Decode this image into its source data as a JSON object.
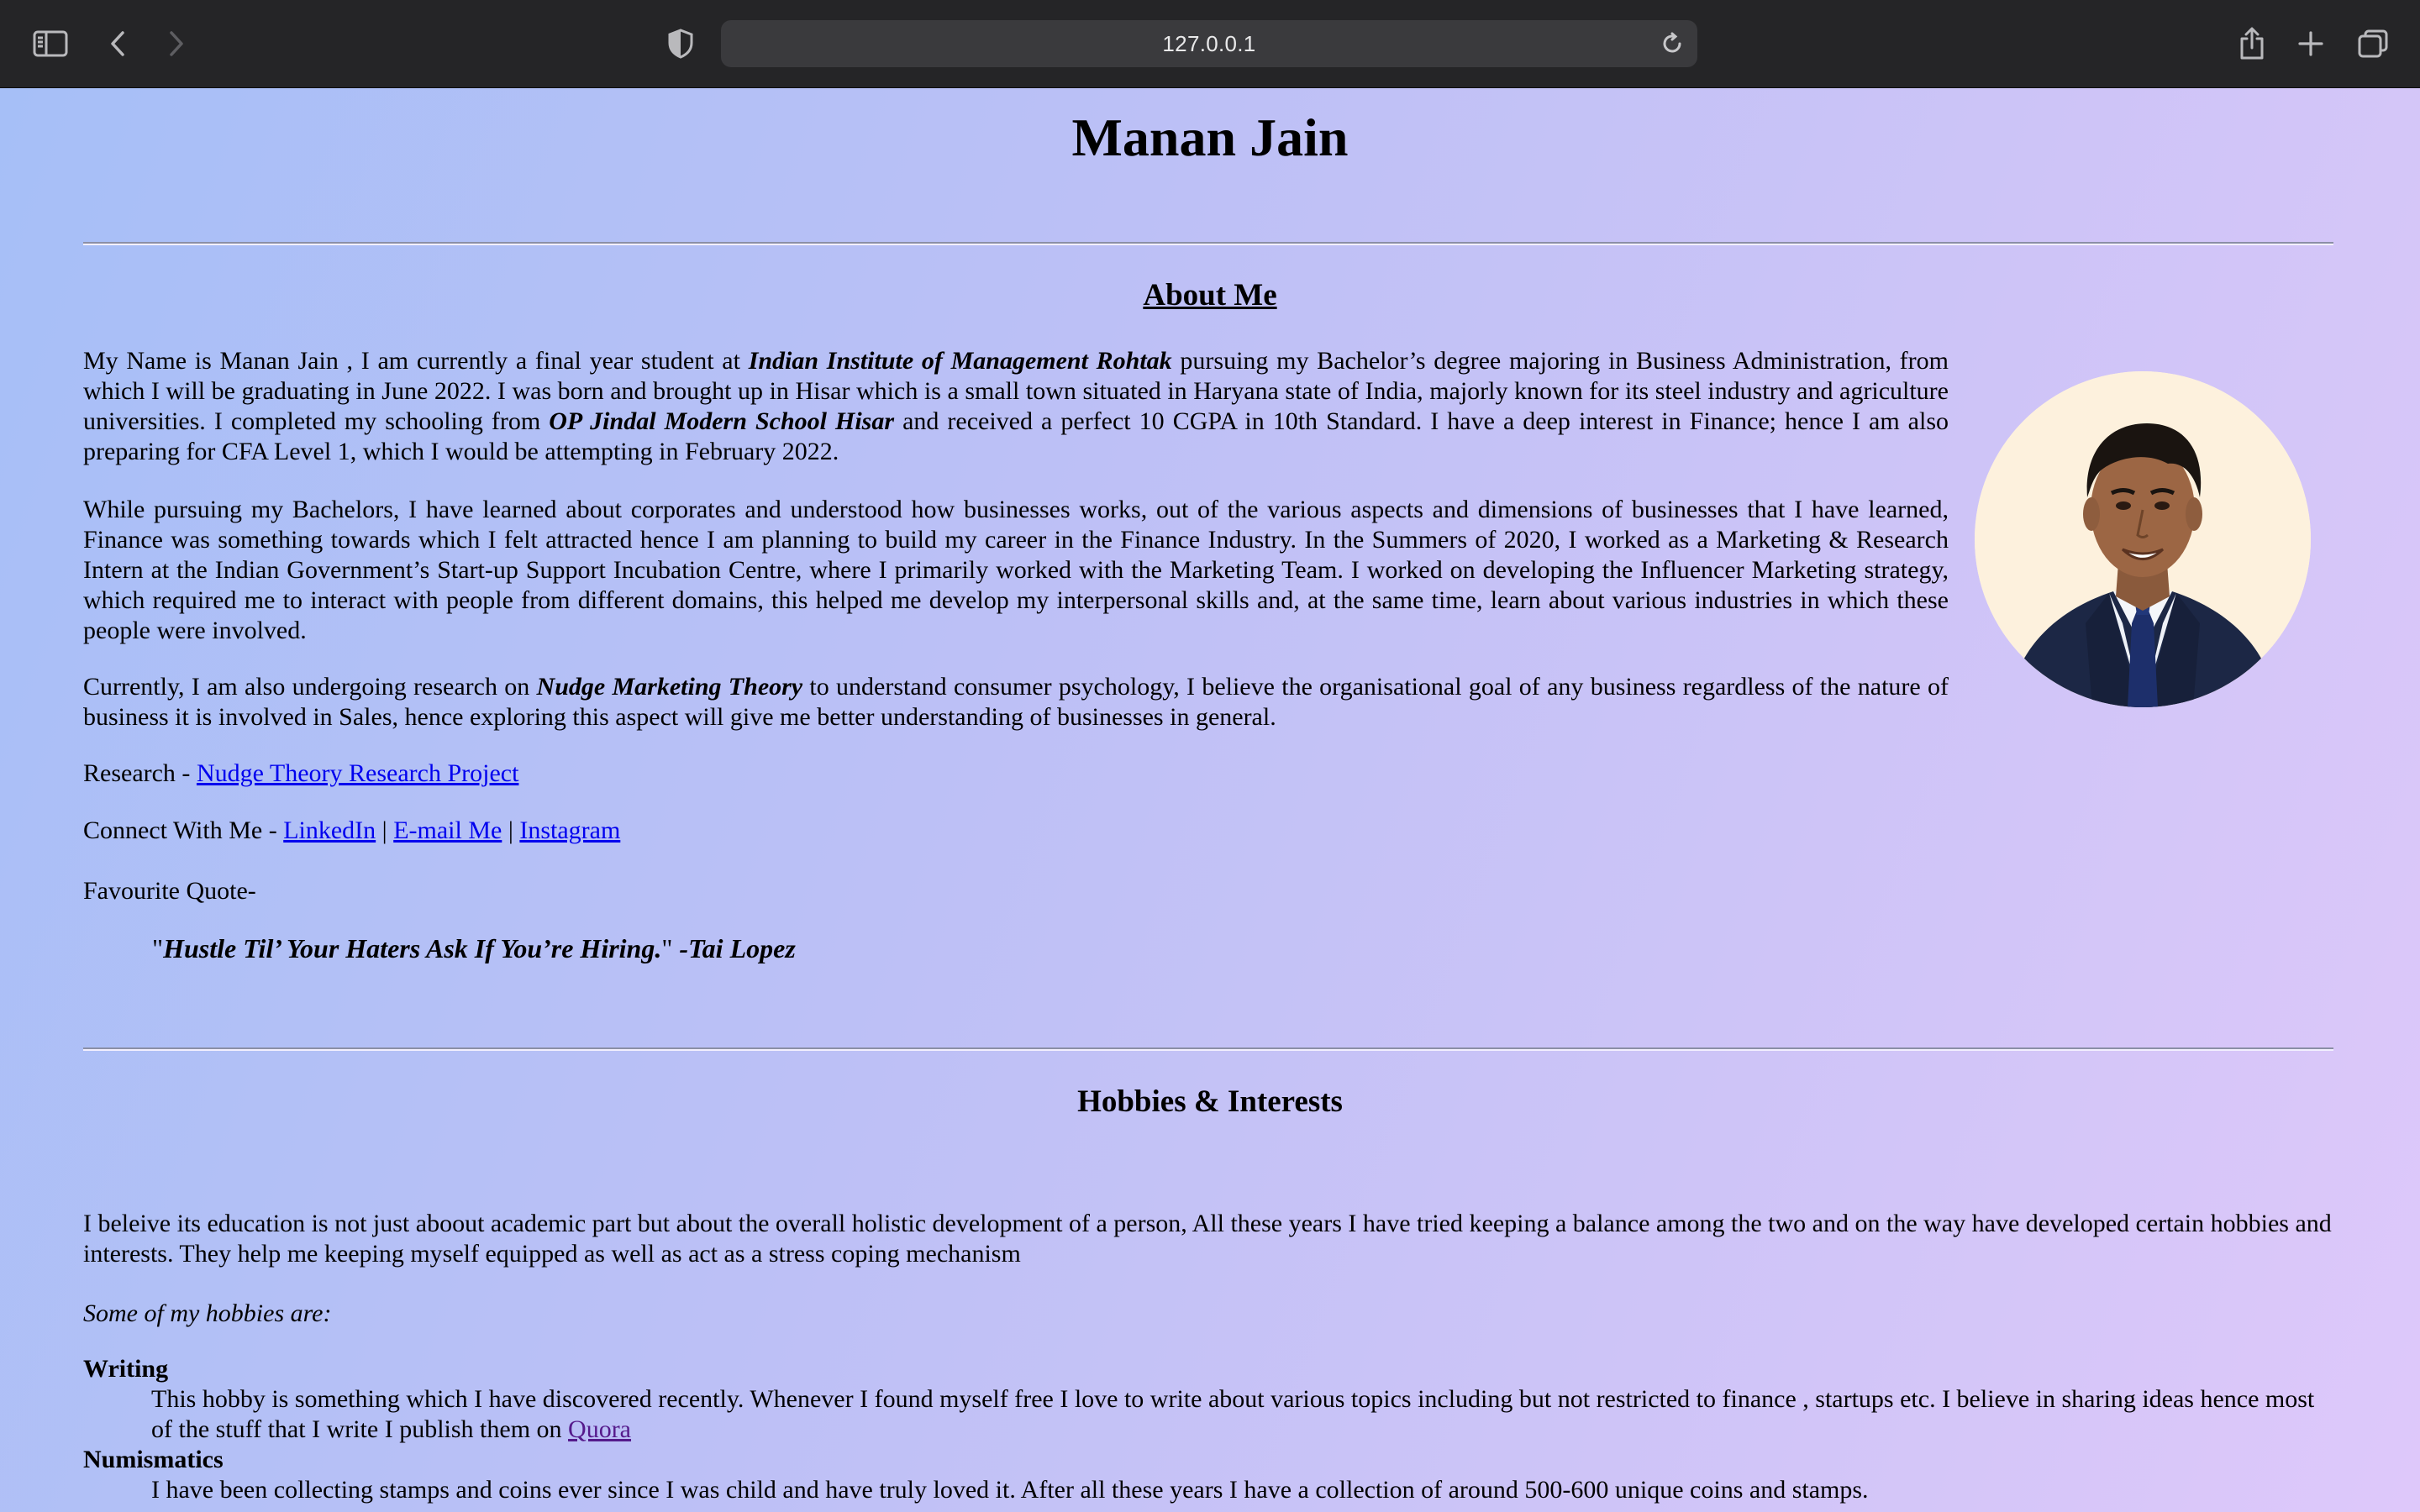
{
  "browser": {
    "url": "127.0.0.1",
    "icons": {
      "sidebar": "sidebar-icon",
      "back": "chevron-left-icon",
      "forward": "chevron-right-icon",
      "privacy": "shield-icon",
      "reload": "reload-icon",
      "share": "share-icon",
      "new_tab": "plus-icon",
      "tabs": "tabs-overview-icon"
    }
  },
  "page": {
    "name": "Manan Jain",
    "about": {
      "title": "About Me",
      "p1": {
        "t1": "My Name is Manan Jain , I am currently a final year student at ",
        "b1": "Indian Institute of Management Rohtak",
        "t2": " pursuing my Bachelor’s degree majoring in Business Administration, from which I will be graduating in June 2022. I was born and brought up in Hisar which is a small town situated in Haryana state of India, majorly known for its steel industry and agriculture universities. I completed my schooling from ",
        "b2": "OP Jindal Modern School Hisar",
        "t3": " and received a perfect 10 CGPA in 10th Standard. I have a deep interest in Finance; hence I am also preparing for CFA Level 1, which I would be attempting in February 2022."
      },
      "p2": "While pursuing my Bachelors, I have learned about corporates and understood how businesses works, out of the various aspects and dimensions of businesses that I have learned, Finance was something towards which I felt attracted hence I am planning to build my career in the Finance Industry. In the Summers of 2020, I worked as a Marketing & Research Intern at the Indian Government’s Start-up Support Incubation Centre, where I primarily worked with the Marketing Team. I worked on developing the Influencer Marketing strategy, which required me to interact with people from different domains, this helped me develop my interpersonal skills and, at the same time, learn about various industries in which these people were involved.",
      "p3": {
        "t1": "Currently, I am also undergoing research on ",
        "b1": "Nudge Marketing Theory",
        "t2": " to understand consumer psychology, I believe the organisational goal of any business regardless of the nature of business it is involved in Sales, hence exploring this aspect will give me better understanding of businesses in general."
      },
      "research_label": "Research - ",
      "research_link": "Nudge Theory Research Project",
      "connect_label": "Connect With Me - ",
      "connect_links": [
        "LinkedIn",
        "E-mail Me",
        "Instagram"
      ],
      "separator": " | ",
      "quote_label": "Favourite Quote-",
      "quote_open": "\"",
      "quote_text": "Hustle Til’ Your Haters Ask If You’re Hiring.",
      "quote_close": "\"",
      "quote_author": " -Tai Lopez"
    },
    "hobbies": {
      "title": "Hobbies & Interests",
      "intro": "I beleive its education is not just aboout academic part but about the overall holistic development of a person, All these years I have tried keeping a balance among the two and on the way have developed certain hobbies and interests. They help me keeping myself equipped as well as act as a stress coping mechanism",
      "subheading": "Some of my hobbies are:",
      "items": [
        {
          "title": "Writing",
          "desc": "This hobby is something which I have discovered recently. Whenever I found myself free I love to write about various topics including but not restricted to finance , startups etc. I believe in sharing ideas hence most of the stuff that I write I publish them on ",
          "link": "Quora"
        },
        {
          "title": "Numismatics",
          "desc": "I have been collecting stamps and coins ever since I was child and have truly loved it. After all these years I have a collection of around 500-600 unique coins and stamps."
        }
      ]
    }
  }
}
